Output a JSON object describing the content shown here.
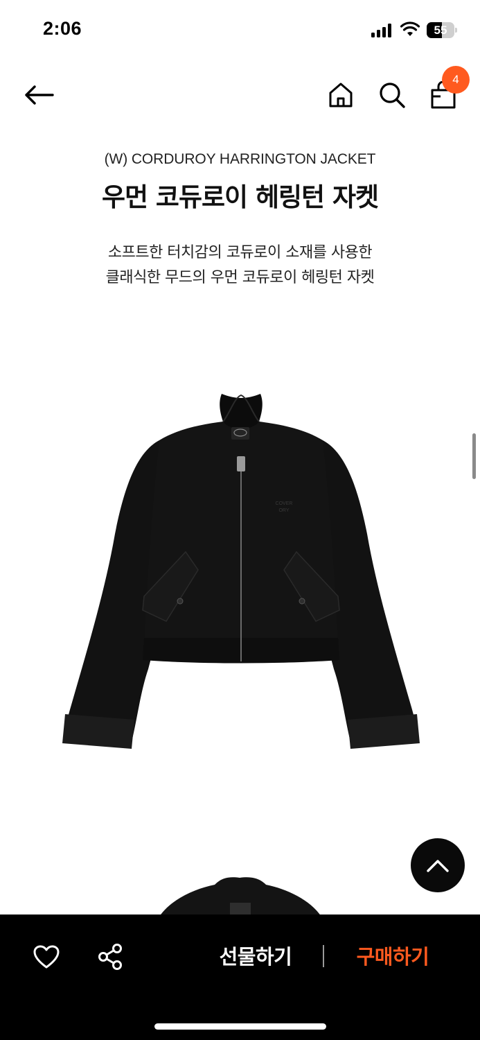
{
  "status_bar": {
    "time": "2:06",
    "battery_level": "55",
    "battery_fraction": 0.55
  },
  "nav": {
    "cart_count": "4"
  },
  "product": {
    "name_en": "(W) CORDUROY HARRINGTON JACKET",
    "name_ko": "우먼 코듀로이 헤링턴 자켓",
    "description_line1": "소프트한 터치감의 코듀로이 소재를 사용한",
    "description_line2": "클래식한 무드의 우먼 코듀로이 헤링턴 자켓",
    "chest_logo": "COVER\nORY"
  },
  "actions": {
    "gift_label": "선물하기",
    "buy_label": "구매하기"
  },
  "colors": {
    "accent": "#ff5a1f",
    "bottom_bar": "#000000",
    "jacket": "#121212"
  },
  "icons": {
    "back": "arrow-left-icon",
    "home": "home-icon",
    "search": "search-icon",
    "bag": "shopping-bag-icon",
    "like": "heart-icon",
    "share": "share-icon",
    "scroll_top": "chevron-up-icon"
  }
}
